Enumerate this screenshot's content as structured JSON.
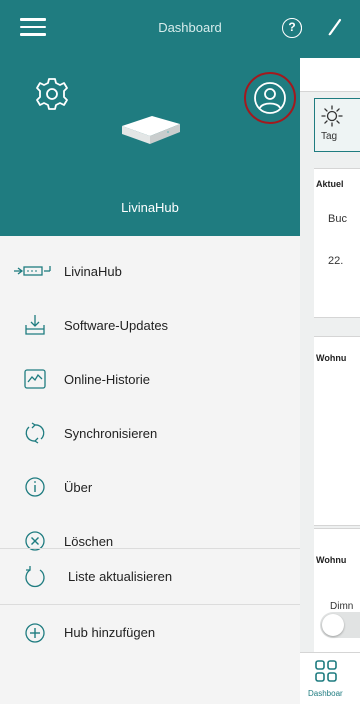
{
  "appbar": {
    "title": "Dashboard",
    "help_icon": "help-circle-icon",
    "edit_icon": "pencil-icon"
  },
  "drawer": {
    "hub_name": "LivinaHub",
    "items": [
      {
        "label": "LivinaHub",
        "icon": "hub-connection-icon"
      },
      {
        "label": "Software-Updates",
        "icon": "software-update-icon"
      },
      {
        "label": "Online-Historie",
        "icon": "history-chart-icon"
      },
      {
        "label": "Synchronisieren",
        "icon": "sync-icon"
      },
      {
        "label": "Über",
        "icon": "info-icon"
      },
      {
        "label": "Löschen",
        "icon": "delete-circle-icon"
      }
    ],
    "footer": [
      {
        "label": "Liste aktualisieren",
        "icon": "refresh-icon"
      },
      {
        "label": "Hub hinzufügen",
        "icon": "add-circle-icon"
      }
    ]
  },
  "content": {
    "day_tab_label": "Tag",
    "card1_title": "Aktuel",
    "card1_text1": "Buc",
    "card1_text2": "22.",
    "card2_title": "Wohnu",
    "card3_title": "Wohnu",
    "card3_text1": "Dimn",
    "bottom_nav_label": "Dashboar"
  },
  "colors": {
    "primary": "#1f7c80",
    "highlight_ring": "#a3191e"
  }
}
